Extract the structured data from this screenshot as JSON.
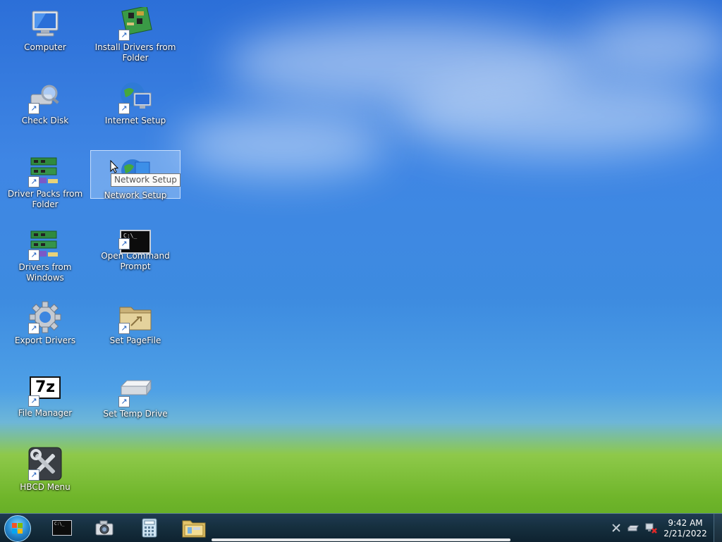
{
  "desktop": {
    "icons": [
      {
        "label": "Computer",
        "icon": "computer-icon",
        "shortcut": false
      },
      {
        "label": "Install Drivers from Folder",
        "icon": "circuit-board-icon",
        "shortcut": true
      },
      {
        "label": "Check Disk",
        "icon": "disk-magnifier-icon",
        "shortcut": true
      },
      {
        "label": "Internet Setup",
        "icon": "globe-monitor-icon",
        "shortcut": true
      },
      {
        "label": "Driver Packs from Folder",
        "icon": "circuit-boards-icon",
        "shortcut": true
      },
      {
        "label": "Network Setup",
        "icon": "network-globe-icon",
        "shortcut": false,
        "selected": true
      },
      {
        "label": "Drivers from Windows",
        "icon": "circuit-boards-icon",
        "shortcut": true
      },
      {
        "label": "Open Command Prompt",
        "icon": "command-prompt-icon",
        "shortcut": true
      },
      {
        "label": "Export Drivers",
        "icon": "gear-icon",
        "shortcut": true
      },
      {
        "label": "Set PageFile",
        "icon": "folder-icon",
        "shortcut": true
      },
      {
        "label": "File Manager",
        "icon": "7zip-icon",
        "shortcut": true
      },
      {
        "label": "Set Temp Drive",
        "icon": "drive-icon",
        "shortcut": true
      },
      {
        "label": "HBCD Menu",
        "icon": "tools-icon",
        "shortcut": true
      }
    ],
    "tooltip": "Network Setup",
    "cmd_prompt_text": "C:\\_",
    "seven_zip_text": "7z"
  },
  "taskbar": {
    "start": "start-orb-icon",
    "pinned": [
      "command-prompt-icon",
      "camera-icon",
      "calculator-icon",
      "file-explorer-icon"
    ],
    "tray": [
      "tools-icon",
      "usb-drive-icon",
      "network-disconnected-icon"
    ],
    "time": "9:42 AM",
    "date": "2/21/2022"
  },
  "colors": {
    "sky": "#3a80e0",
    "grass": "#6fb52a",
    "taskbar": "#16303f",
    "selection": "#c8e1ff"
  }
}
